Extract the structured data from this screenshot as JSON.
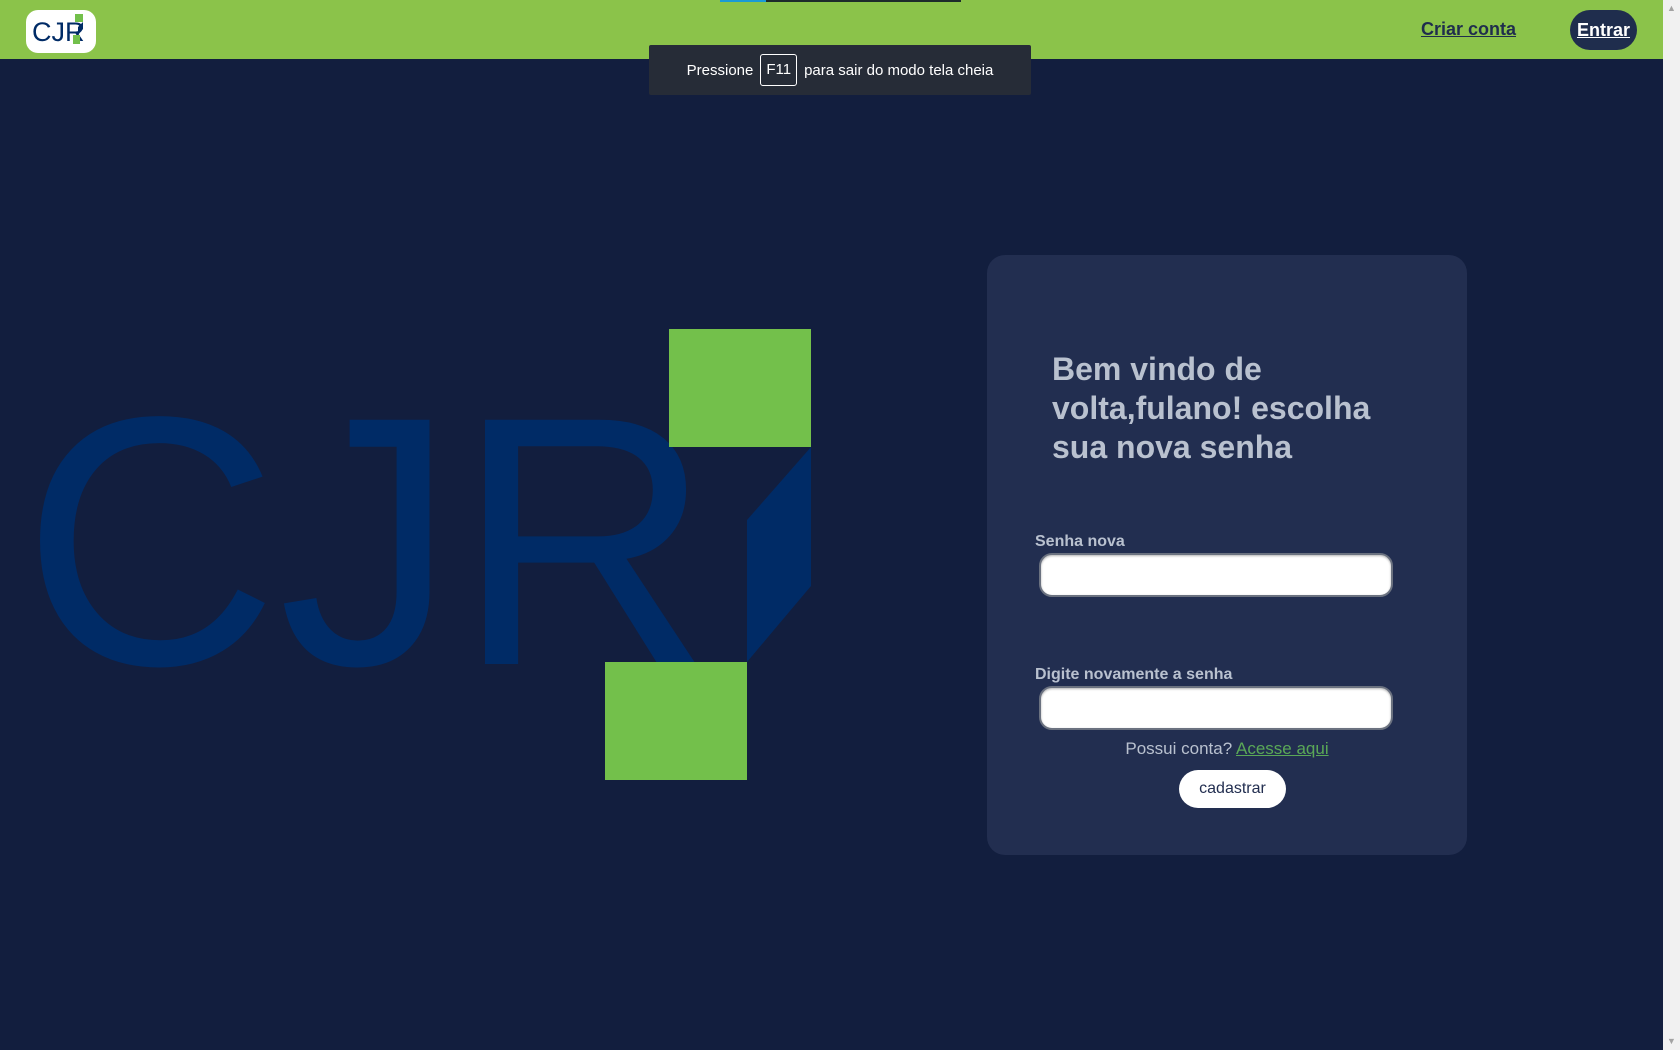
{
  "header": {
    "logo_text": "CJR",
    "criar_conta": "Criar conta",
    "entrar": "Entrar",
    "load_progress": 0.19
  },
  "toast": {
    "before": "Pressione",
    "key": "F11",
    "after": "para sair do modo tela cheia"
  },
  "brand": {
    "logo_text": "CJR",
    "green": "#73c04b",
    "navy": "#002b66",
    "background": "#121e3e"
  },
  "card": {
    "title": "Bem vindo de volta,fulano! escolha sua nova senha",
    "label_new_password": "Senha nova",
    "label_repeat_password": "Digite novamente a senha",
    "account_question": "Possui conta?",
    "account_link": "Acesse aqui",
    "submit": "cadastrar"
  },
  "icons": {
    "scroll_up": "triangle-up-icon",
    "scroll_down": "triangle-down-icon"
  }
}
